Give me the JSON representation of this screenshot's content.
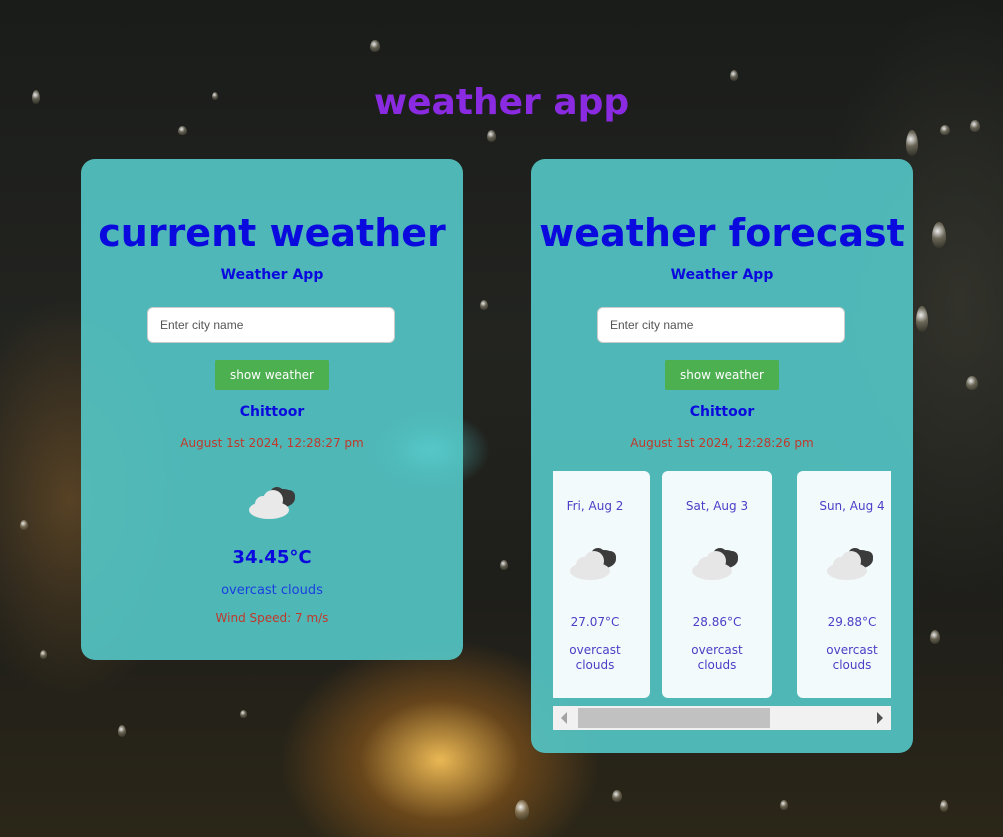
{
  "app": {
    "title": "weather app"
  },
  "current": {
    "heading": "current weather",
    "subtitle": "Weather App",
    "input_placeholder": "Enter city name",
    "button_label": "show weather",
    "city": "Chittoor",
    "datetime": "August 1st 2024, 12:28:27 pm",
    "icon": "overcast-clouds-icon",
    "temperature": "34.45°C",
    "description": "overcast clouds",
    "wind": "Wind Speed: 7 m/s"
  },
  "forecast": {
    "heading": "weather forecast",
    "subtitle": "Weather App",
    "input_placeholder": "Enter city name",
    "button_label": "show weather",
    "city": "Chittoor",
    "datetime": "August 1st 2024, 12:28:26 pm",
    "days": [
      {
        "date": "Fri, Aug 2",
        "temp": "27.07°C",
        "desc_line1": "overcast",
        "desc_line2": "clouds",
        "icon": "overcast-clouds-icon"
      },
      {
        "date": "Sat, Aug 3",
        "temp": "28.86°C",
        "desc_line1": "overcast",
        "desc_line2": "clouds",
        "icon": "overcast-clouds-icon"
      },
      {
        "date": "Sun, Aug 4",
        "temp": "29.88°C",
        "desc_line1": "overcast",
        "desc_line2": "clouds",
        "icon": "overcast-clouds-icon"
      }
    ]
  },
  "colors": {
    "title": "#8a2be2",
    "heading": "#0a0adf",
    "card_bg": "#54c8c8",
    "button": "#4caf50",
    "date_text": "#c0392b"
  }
}
